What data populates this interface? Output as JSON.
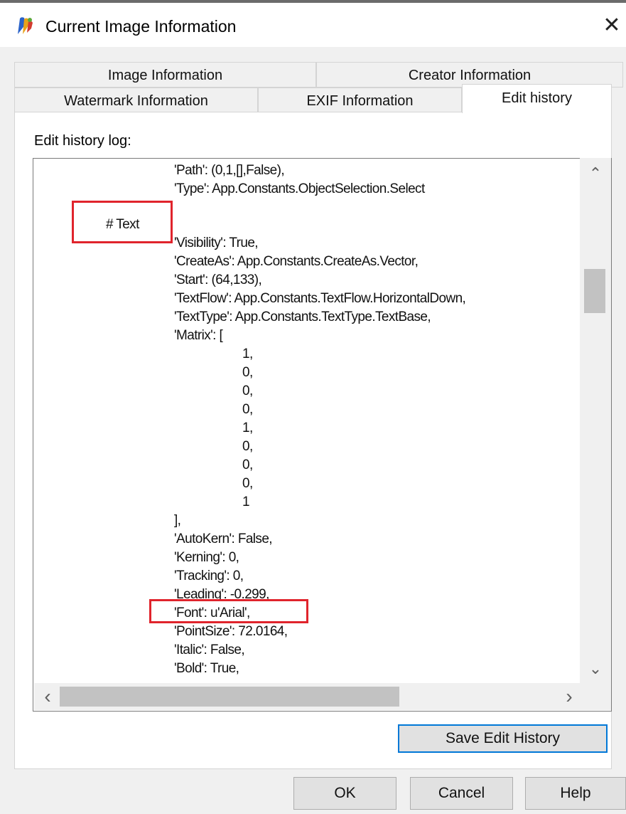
{
  "window": {
    "title": "Current Image Information",
    "close_glyph": "✕",
    "icon": "app-logo-icon"
  },
  "tabs": {
    "row1": [
      {
        "label": "Image Information"
      },
      {
        "label": "Creator Information"
      }
    ],
    "row2": [
      {
        "label": "Watermark Information"
      },
      {
        "label": "EXIF Information"
      },
      {
        "label": "Edit history",
        "active": true
      }
    ]
  },
  "edit_history": {
    "label": "Edit history log:",
    "lines": [
      "'Path': (0,1,[],False),",
      "'Type': App.Constants.ObjectSelection.Select",
      "# Text",
      "'Visibility': True,",
      "'CreateAs': App.Constants.CreateAs.Vector,",
      "'Start': (64,133),",
      "'TextFlow': App.Constants.TextFlow.HorizontalDown,",
      "'TextType': App.Constants.TextType.TextBase,",
      "'Matrix': [",
      "1,",
      "0,",
      "0,",
      "0,",
      "1,",
      "0,",
      "0,",
      "0,",
      "1",
      "],",
      "'AutoKern': False,",
      "'Kerning': 0,",
      "'Tracking': 0,",
      "'Leading': -0.299,",
      "'Font': u'Arial',",
      "'PointSize': 72.0164,",
      "'Italic': False,",
      "'Bold': True,"
    ]
  },
  "scrollbar": {
    "up": "⌃",
    "down": "⌄",
    "left": "‹",
    "right": "›"
  },
  "buttons": {
    "save_edit_history": "Save Edit History",
    "ok": "OK",
    "cancel": "Cancel",
    "help": "Help"
  },
  "colors": {
    "highlight": "#e0242c",
    "focus": "#0078d7",
    "dialog_bg": "#f0f0f0"
  }
}
